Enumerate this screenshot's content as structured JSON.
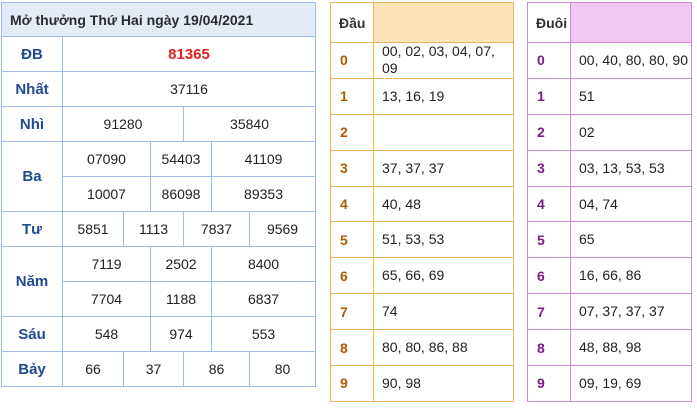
{
  "results": {
    "title": "Mở thưởng Thứ Hai ngày 19/04/2021",
    "rows": [
      {
        "label": "ĐB",
        "nums": [
          "81365"
        ]
      },
      {
        "label": "Nhất",
        "nums": [
          "37116"
        ]
      },
      {
        "label": "Nhì",
        "nums": [
          "91280",
          "35840"
        ]
      },
      {
        "label": "Ba",
        "nums": [
          "07090",
          "54403",
          "41109",
          "10007",
          "86098",
          "89353"
        ]
      },
      {
        "label": "Tư",
        "nums": [
          "5851",
          "1113",
          "7837",
          "9569"
        ]
      },
      {
        "label": "Năm",
        "nums": [
          "7119",
          "2502",
          "8400",
          "7704",
          "1188",
          "6837"
        ]
      },
      {
        "label": "Sáu",
        "nums": [
          "548",
          "974",
          "553"
        ]
      },
      {
        "label": "Bảy",
        "nums": [
          "66",
          "37",
          "86",
          "80"
        ]
      }
    ],
    "colors": {
      "special": "#e02020",
      "label": "#214a91",
      "border": "#9fbbe8",
      "title_bg": "#e3ebf7"
    }
  },
  "dau": {
    "header": "Đầu",
    "rows": [
      {
        "k": "0",
        "v": "00, 02, 03, 04, 07, 09"
      },
      {
        "k": "1",
        "v": "13, 16, 19"
      },
      {
        "k": "2",
        "v": ""
      },
      {
        "k": "3",
        "v": "37, 37, 37"
      },
      {
        "k": "4",
        "v": "40, 48"
      },
      {
        "k": "5",
        "v": "51, 53, 53"
      },
      {
        "k": "6",
        "v": "65, 66, 69"
      },
      {
        "k": "7",
        "v": "74"
      },
      {
        "k": "8",
        "v": "80, 80, 86, 88"
      },
      {
        "k": "9",
        "v": "90, 98"
      }
    ],
    "colors": {
      "border": "#f1b35e",
      "header_bg": "#ffe3b8",
      "key": "#b25a00"
    }
  },
  "duoi": {
    "header": "Đuôi",
    "rows": [
      {
        "k": "0",
        "v": "00, 40, 80, 80, 90"
      },
      {
        "k": "1",
        "v": "51"
      },
      {
        "k": "2",
        "v": "02"
      },
      {
        "k": "3",
        "v": "03, 13, 53, 53"
      },
      {
        "k": "4",
        "v": "04, 74"
      },
      {
        "k": "5",
        "v": "65"
      },
      {
        "k": "6",
        "v": "16, 66, 86"
      },
      {
        "k": "7",
        "v": "07, 37, 37, 37"
      },
      {
        "k": "8",
        "v": "48, 88, 98"
      },
      {
        "k": "9",
        "v": "09, 19, 69"
      }
    ],
    "colors": {
      "border": "#d08ad8",
      "header_bg": "#f1c8f4",
      "key": "#7b1e86"
    }
  }
}
